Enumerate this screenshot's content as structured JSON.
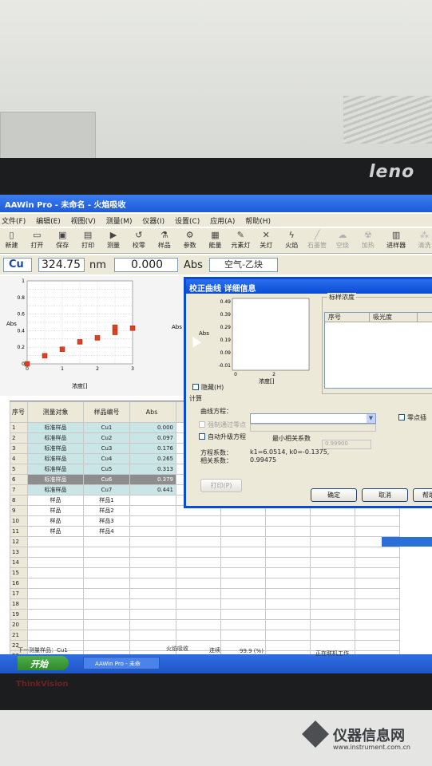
{
  "monitor": {
    "brand": "leno",
    "model": "ThinkVision"
  },
  "window": {
    "title": "AAWin Pro - 未命名 - 火焰吸收"
  },
  "menu": [
    "文件(F)",
    "编辑(E)",
    "视图(V)",
    "测量(M)",
    "仪器(I)",
    "设置(C)",
    "应用(A)",
    "帮助(H)"
  ],
  "toolbar": [
    {
      "label": "新建",
      "icon": "new-file-icon"
    },
    {
      "label": "打开",
      "icon": "folder-open-icon"
    },
    {
      "label": "保存",
      "icon": "save-icon"
    },
    {
      "label": "打印",
      "icon": "print-icon"
    },
    {
      "label": "测量",
      "icon": "play-icon"
    },
    {
      "label": "校零",
      "icon": "zero-icon"
    },
    {
      "label": "样品",
      "icon": "sample-icon"
    },
    {
      "label": "参数",
      "icon": "gear-icon"
    },
    {
      "label": "能量",
      "icon": "energy-icon"
    },
    {
      "label": "元素灯",
      "icon": "lamp-icon"
    },
    {
      "label": "关灯",
      "icon": "lamp-off-icon"
    },
    {
      "label": "火焰",
      "icon": "flame-icon"
    },
    {
      "label": "石墨管",
      "icon": "graphite-icon"
    },
    {
      "label": "空烧",
      "icon": "burn-icon"
    },
    {
      "label": "加热",
      "icon": "heat-icon"
    },
    {
      "label": "进样器",
      "icon": "sampler-icon"
    },
    {
      "label": "清洗",
      "icon": "clean-icon"
    }
  ],
  "info": {
    "element": "Cu",
    "wavelength": "324.75",
    "wavelength_unit": "nm",
    "absorbance": "0.000",
    "absorbance_unit": "Abs",
    "flame_type": "空气-乙炔"
  },
  "main_chart": {
    "ylabel": "Abs",
    "xlabel": "浓度[]",
    "chart_data": {
      "type": "scatter",
      "x": [
        0,
        0.5,
        1,
        1.5,
        2,
        2.5,
        2.5,
        3
      ],
      "y": [
        0.0,
        0.097,
        0.176,
        0.265,
        0.313,
        0.379,
        0.441,
        0.43
      ],
      "xlim": [
        0,
        3
      ],
      "ylim": [
        0,
        1
      ],
      "xticks": [
        "0",
        "1",
        "2",
        "3"
      ],
      "yticks": [
        "0",
        "0.2",
        "0.4",
        "0.6",
        "0.8",
        "1"
      ]
    }
  },
  "table": {
    "headers": [
      "序号",
      "测量对象",
      "样品编号",
      "Abs"
    ],
    "rows": [
      {
        "n": "1",
        "obj": "标准样品",
        "id": "Cu1",
        "abs": "0.000"
      },
      {
        "n": "2",
        "obj": "标准样品",
        "id": "Cu2",
        "abs": "0.097"
      },
      {
        "n": "3",
        "obj": "标准样品",
        "id": "Cu3",
        "abs": "0.176"
      },
      {
        "n": "4",
        "obj": "标准样品",
        "id": "Cu4",
        "abs": "0.265"
      },
      {
        "n": "5",
        "obj": "标准样品",
        "id": "Cu5",
        "abs": "0.313"
      },
      {
        "n": "6",
        "obj": "标准样品",
        "id": "Cu6",
        "abs": "0.379"
      },
      {
        "n": "7",
        "obj": "标准样品",
        "id": "Cu7",
        "abs": "0.441"
      },
      {
        "n": "8",
        "obj": "样品",
        "id": "样品1",
        "abs": ""
      },
      {
        "n": "9",
        "obj": "样品",
        "id": "样品2",
        "abs": ""
      },
      {
        "n": "10",
        "obj": "样品",
        "id": "样品3",
        "abs": ""
      },
      {
        "n": "11",
        "obj": "样品",
        "id": "样品4",
        "abs": ""
      },
      {
        "n": "12",
        "obj": "",
        "id": "",
        "abs": ""
      },
      {
        "n": "13",
        "obj": "",
        "id": "",
        "abs": ""
      },
      {
        "n": "14",
        "obj": "",
        "id": "",
        "abs": ""
      },
      {
        "n": "15",
        "obj": "",
        "id": "",
        "abs": ""
      },
      {
        "n": "16",
        "obj": "",
        "id": "",
        "abs": ""
      },
      {
        "n": "17",
        "obj": "",
        "id": "",
        "abs": ""
      },
      {
        "n": "18",
        "obj": "",
        "id": "",
        "abs": ""
      },
      {
        "n": "19",
        "obj": "",
        "id": "",
        "abs": ""
      },
      {
        "n": "20",
        "obj": "",
        "id": "",
        "abs": ""
      },
      {
        "n": "21",
        "obj": "",
        "id": "",
        "abs": ""
      },
      {
        "n": "22",
        "obj": "",
        "id": "",
        "abs": ""
      },
      {
        "n": "23",
        "obj": "",
        "id": "",
        "abs": ""
      },
      {
        "n": "24",
        "obj": "",
        "id": "",
        "abs": ""
      }
    ],
    "tab_label": "下一测量样品：Cu1"
  },
  "statusbar": {
    "mode": "火焰吸收",
    "conn": "连续",
    "value": "99.9 (%)",
    "state": "正在联机工作"
  },
  "taskbar": {
    "start": "开始",
    "task": "AAWin Pro - 未命"
  },
  "dialog": {
    "title": "校正曲线 详细信息",
    "chart": {
      "ylabel": "Abs",
      "xlabel": "浓度[]",
      "yticks": [
        "0.49",
        "0.39",
        "0.29",
        "0.19",
        "0.09",
        "-0.01"
      ],
      "xticks": [
        "0",
        "2"
      ]
    },
    "std_group": "标样浓度",
    "std_cols": [
      "序号",
      "吸光度"
    ],
    "hide_label": "隐藏(H)",
    "calc_label": "计算",
    "curve_label": "曲线方程：",
    "zero_label": "零点插",
    "forced_label": "强制通过零点",
    "auto_label": "自动升级方程",
    "min_coef_label": "最小相关系数",
    "min_coef_value": "0.99900",
    "coef_label": "方程系数：",
    "coef_value": "k1=6.0514, k0=-0.1375,",
    "corr_label": "相关系数：",
    "corr_value": "0.99475",
    "print_btn": "打印(P)",
    "ok_btn": "确定",
    "cancel_btn": "取消",
    "help_btn": "帮助"
  },
  "watermark": {
    "name": "仪器信息网",
    "url": "www.instrument.com.cn"
  }
}
